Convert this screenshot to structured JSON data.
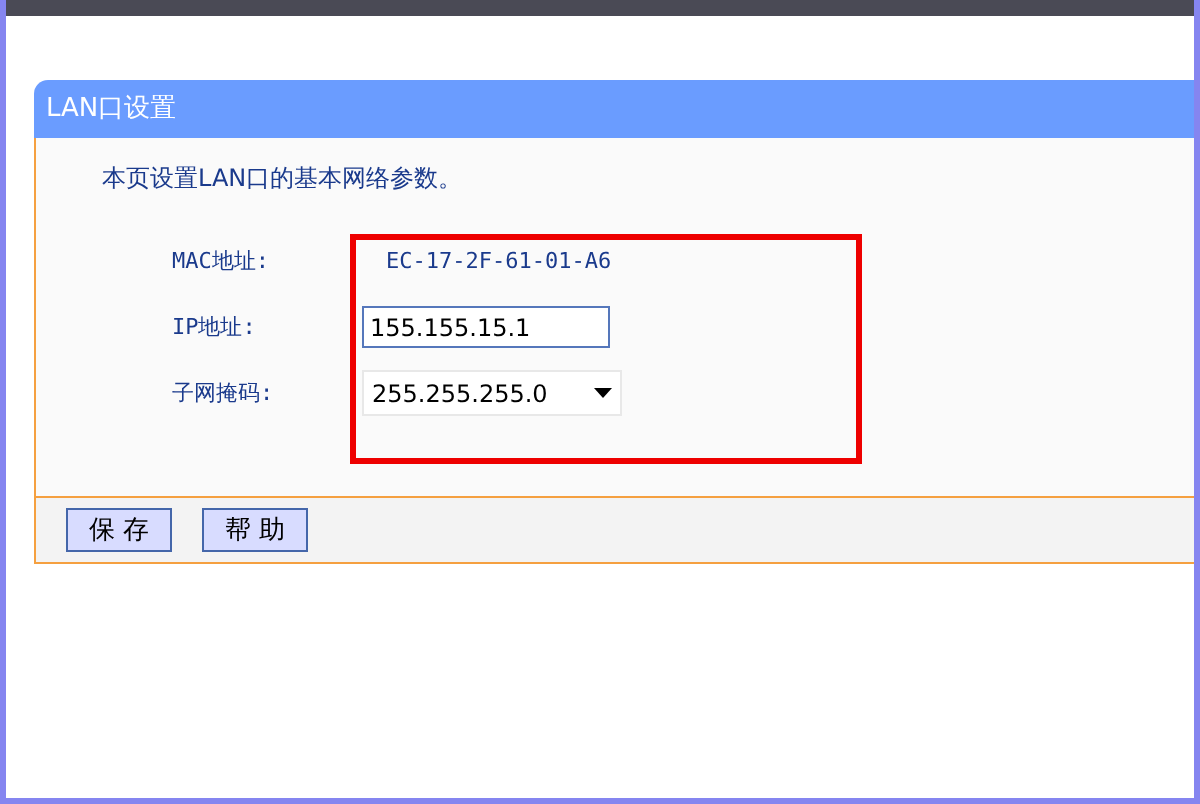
{
  "panel": {
    "title": "LAN口设置",
    "description": "本页设置LAN口的基本网络参数。",
    "fields": [
      {
        "kind": "text",
        "label": "MAC地址:",
        "value": "EC-17-2F-61-01-A6"
      },
      {
        "kind": "input",
        "label": "IP地址:",
        "value": "155.155.15.1"
      },
      {
        "kind": "select",
        "label": "子网掩码:",
        "value": "255.255.255.0"
      }
    ],
    "buttons": [
      "保 存",
      "帮 助"
    ]
  }
}
